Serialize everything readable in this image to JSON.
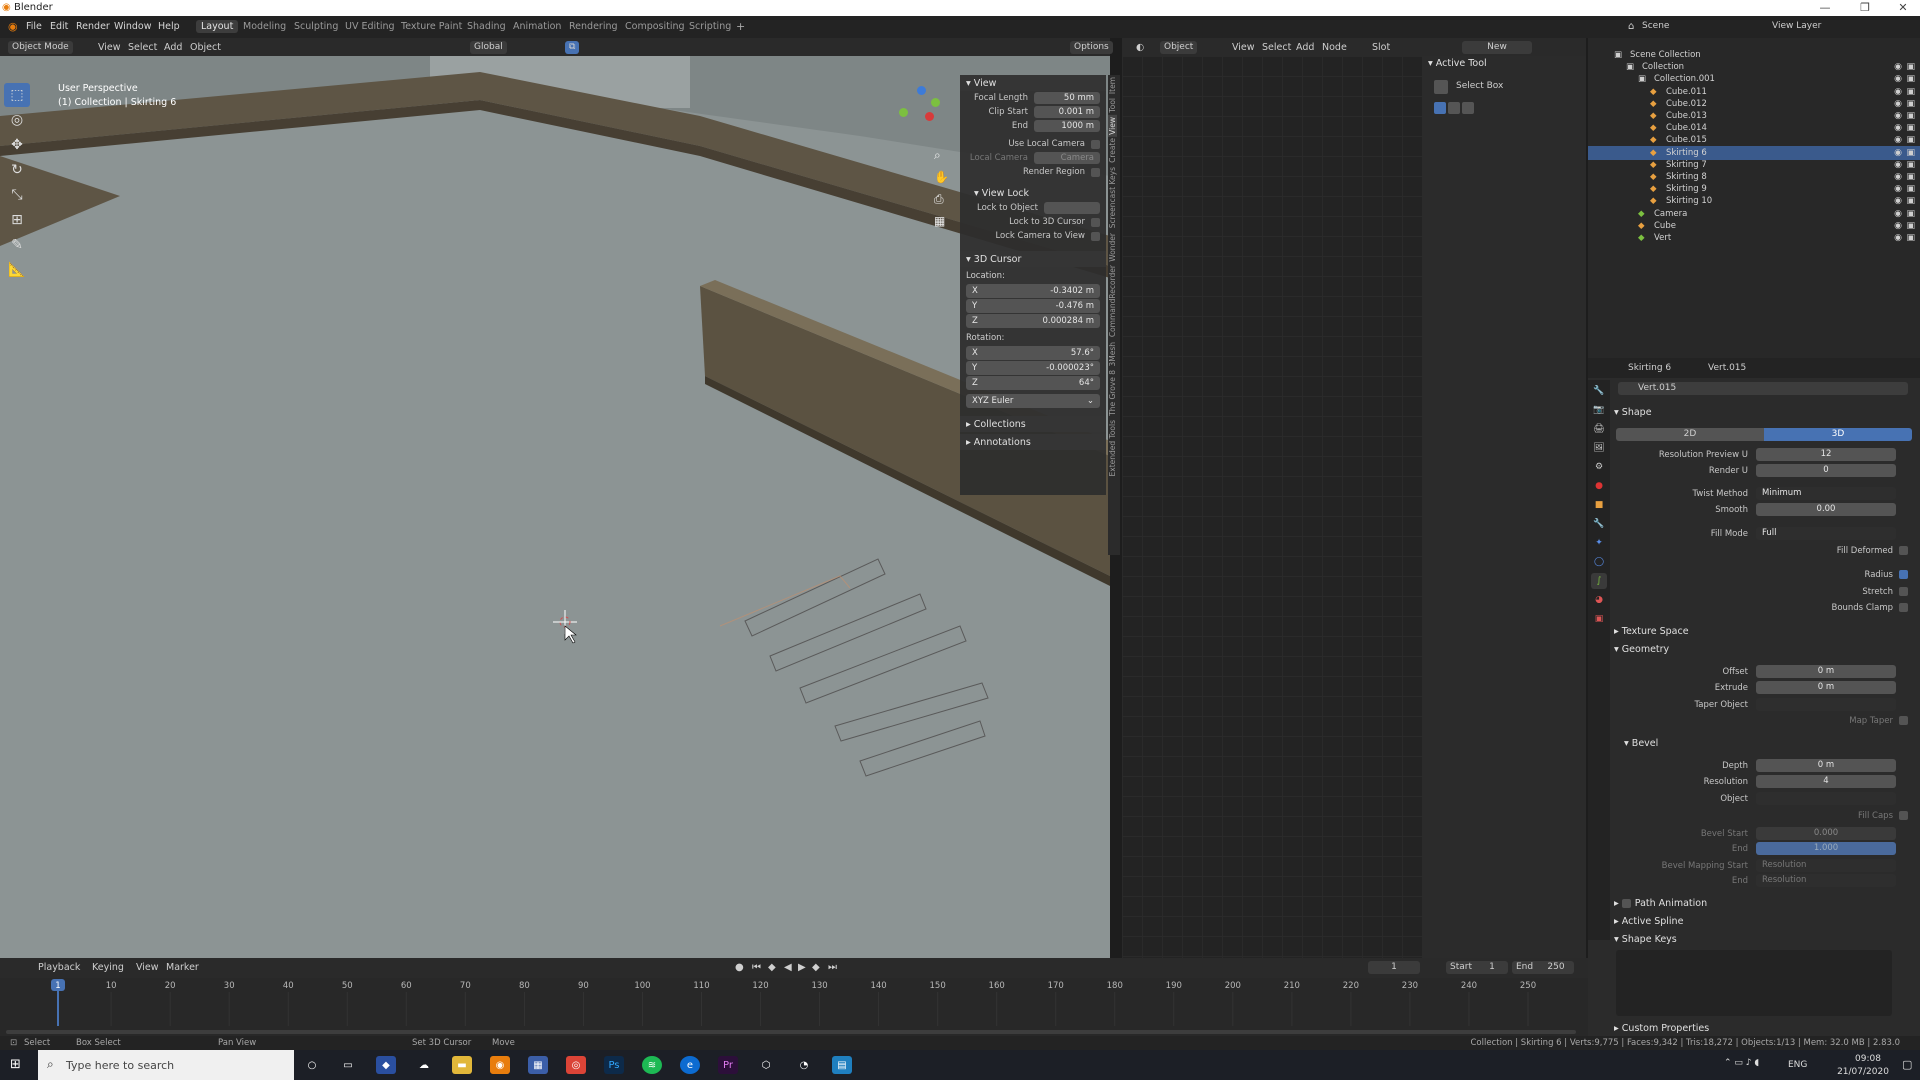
{
  "window": {
    "title": "Blender",
    "minimize": "—",
    "maximize": "❐",
    "close": "✕"
  },
  "menu": [
    "File",
    "Edit",
    "Render",
    "Window",
    "Help"
  ],
  "workspaces": [
    "Layout",
    "Modeling",
    "Sculpting",
    "UV Editing",
    "Texture Paint",
    "Shading",
    "Animation",
    "Rendering",
    "Compositing",
    "Scripting"
  ],
  "active_workspace": "Layout",
  "viewport_header": {
    "mode": "Object Mode",
    "menus": [
      "View",
      "Select",
      "Add",
      "Object"
    ],
    "transform": "Global",
    "options": "Options"
  },
  "viewport": {
    "perspective": "User Perspective",
    "collection_label": "(1) Collection | Skirting 6"
  },
  "npanel": {
    "view_title": "View",
    "focal_length_label": "Focal Length",
    "focal_length": "50 mm",
    "clip_start_label": "Clip Start",
    "clip_start": "0.001 m",
    "end_label": "End",
    "end": "1000 m",
    "use_local_camera": "Use Local Camera",
    "local_camera_label": "Local Camera",
    "local_camera": "Camera",
    "render_region": "Render Region",
    "view_lock_title": "View Lock",
    "lock_to_object": "Lock to Object",
    "lock_to_cursor": "Lock to 3D Cursor",
    "lock_camera": "Lock Camera to View",
    "cursor_title": "3D Cursor",
    "location_label": "Location:",
    "loc_x": "-0.3402 m",
    "loc_y": "-0.476 m",
    "loc_z": "0.000284 m",
    "rotation_label": "Rotation:",
    "rot_x": "57.6°",
    "rot_y": "-0.000023°",
    "rot_z": "64°",
    "rotation_mode": "XYZ Euler",
    "collections": "Collections",
    "annotations": "Annotations"
  },
  "vertical_tabs": [
    "Item",
    "Tool",
    "View",
    "Create",
    "Screencast Keys",
    "Wonder",
    "CommandRecorder",
    "3Mesh",
    "The Grove 8",
    "Extended Tools"
  ],
  "node_header": {
    "object": "Object",
    "menus": [
      "View",
      "Select",
      "Add",
      "Node"
    ],
    "slot": "Slot",
    "new": "New"
  },
  "active_tool": {
    "title": "Active Tool",
    "tool": "Select Box"
  },
  "outliner_header": {
    "scene": "Scene",
    "view_layer": "View Layer"
  },
  "outliner": [
    {
      "name": "Scene Collection",
      "indent": 0,
      "sel": false
    },
    {
      "name": "Collection",
      "indent": 1,
      "sel": false
    },
    {
      "name": "Collection.001",
      "indent": 2,
      "sel": false
    },
    {
      "name": "Cube.011",
      "indent": 3,
      "sel": false
    },
    {
      "name": "Cube.012",
      "indent": 3,
      "sel": false
    },
    {
      "name": "Cube.013",
      "indent": 3,
      "sel": false
    },
    {
      "name": "Cube.014",
      "indent": 3,
      "sel": false
    },
    {
      "name": "Cube.015",
      "indent": 3,
      "sel": false
    },
    {
      "name": "Skirting 6",
      "indent": 3,
      "sel": true
    },
    {
      "name": "Skirting 7",
      "indent": 3,
      "sel": false
    },
    {
      "name": "Skirting 8",
      "indent": 3,
      "sel": false
    },
    {
      "name": "Skirting 9",
      "indent": 3,
      "sel": false
    },
    {
      "name": "Skirting 10",
      "indent": 3,
      "sel": false
    },
    {
      "name": "Camera",
      "indent": 2,
      "sel": false
    },
    {
      "name": "Cube",
      "indent": 2,
      "sel": false
    },
    {
      "name": "Vert",
      "indent": 2,
      "sel": false
    }
  ],
  "props": {
    "object": "Skirting 6",
    "data": "Vert.015",
    "datablock": "Vert.015",
    "shape": "Shape",
    "btn_2d": "2D",
    "btn_3d": "3D",
    "res_preview_label": "Resolution Preview U",
    "res_preview": "12",
    "render_u_label": "Render U",
    "render_u": "0",
    "twist_label": "Twist Method",
    "twist": "Minimum",
    "smooth_label": "Smooth",
    "smooth": "0.00",
    "fill_mode_label": "Fill Mode",
    "fill_mode": "Full",
    "fill_deformed": "Fill Deformed",
    "radius": "Radius",
    "stretch": "Stretch",
    "bounds_clamp": "Bounds Clamp",
    "texture_space": "Texture Space",
    "geometry": "Geometry",
    "offset_label": "Offset",
    "offset": "0 m",
    "extrude_label": "Extrude",
    "extrude": "0 m",
    "taper_label": "Taper Object",
    "map_taper": "Map Taper",
    "bevel": "Bevel",
    "depth_label": "Depth",
    "depth": "0 m",
    "resolution_label": "Resolution",
    "resolution": "4",
    "object_label": "Object",
    "fill_caps": "Fill Caps",
    "bevel_start_label": "Bevel Start",
    "bevel_start": "0.000",
    "bevel_end_label": "End",
    "bevel_end": "1.000",
    "mapping_start_label": "Bevel Mapping Start",
    "mapping_start": "Resolution",
    "mapping_end_label": "End",
    "mapping_end": "Resolution",
    "path_animation": "Path Animation",
    "active_spline": "Active Spline",
    "shape_keys": "Shape Keys",
    "custom_properties": "Custom Properties"
  },
  "timeline": {
    "menus": [
      "Playback",
      "Keying",
      "View",
      "Marker"
    ],
    "current_frame": "1",
    "start_label": "Start",
    "start": "1",
    "end_label": "End",
    "end": "250",
    "ticks": [
      "1",
      "10",
      "20",
      "30",
      "40",
      "50",
      "60",
      "70",
      "80",
      "90",
      "100",
      "110",
      "120",
      "130",
      "140",
      "150",
      "160",
      "170",
      "180",
      "190",
      "200",
      "210",
      "220",
      "230",
      "240",
      "250"
    ]
  },
  "status": {
    "select": "Select",
    "box_select": "Box Select",
    "pan_view": "Pan View",
    "set_cursor": "Set 3D Cursor",
    "move": "Move",
    "stats": "Collection | Skirting 6 | Verts:9,775 | Faces:9,342 | Tris:18,272 | Objects:1/13 | Mem: 32.0 MB | 2.83.0"
  },
  "taskbar": {
    "search": "Type here to search",
    "lang": "ENG",
    "time": "09:08",
    "date": "21/07/2020"
  }
}
